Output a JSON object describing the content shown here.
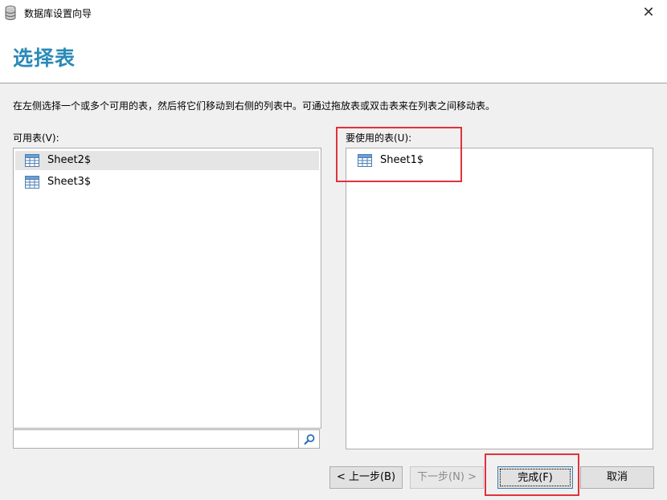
{
  "window": {
    "title": "数据库设置向导",
    "close_glyph": "✕"
  },
  "header": {
    "title": "选择表"
  },
  "description": "在左侧选择一个或多个可用的表，然后将它们移动到右侧的列表中。可通过拖放表或双击表来在列表之间移动表。",
  "available": {
    "label": "可用表(V):",
    "items": [
      {
        "name": "Sheet2$",
        "selected": true
      },
      {
        "name": "Sheet3$",
        "selected": false
      }
    ],
    "search_value": ""
  },
  "used": {
    "label": "要使用的表(U):",
    "items": [
      {
        "name": "Sheet1$"
      }
    ]
  },
  "buttons": {
    "back": "< 上一步(B)",
    "next": "下一步(N) >",
    "finish": "完成(F)",
    "cancel": "取消"
  },
  "colors": {
    "header_title": "#2a8ab8",
    "highlight": "#e0323c",
    "selection": "#e5e5e5"
  }
}
